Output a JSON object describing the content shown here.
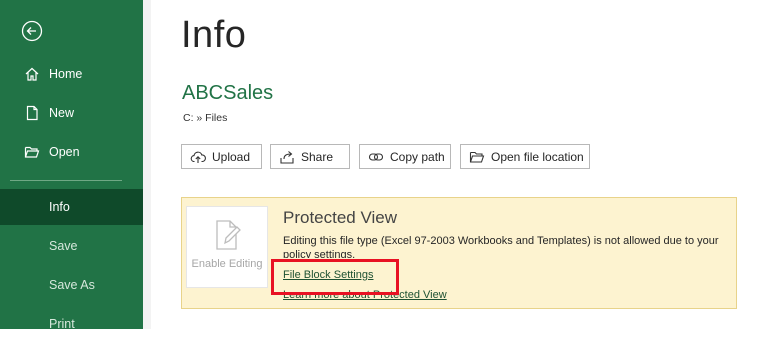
{
  "sidebar": {
    "back_icon": "back-arrow-icon",
    "items": [
      {
        "label": "Home",
        "icon": "home-icon"
      },
      {
        "label": "New",
        "icon": "new-file-icon"
      },
      {
        "label": "Open",
        "icon": "folder-open-icon"
      },
      {
        "label": "Info",
        "active": true
      },
      {
        "label": "Save"
      },
      {
        "label": "Save As"
      },
      {
        "label": "Print"
      }
    ],
    "colors": {
      "background": "#217346",
      "active": "#0f4a2a"
    }
  },
  "main": {
    "title": "Info",
    "file_name": "ABCSales",
    "file_path": "C: » Files",
    "actions": [
      {
        "label": "Upload",
        "icon": "upload-icon"
      },
      {
        "label": "Share",
        "icon": "share-icon"
      },
      {
        "label": "Copy path",
        "icon": "link-icon"
      },
      {
        "label": "Open file location",
        "icon": "folder-icon"
      }
    ]
  },
  "protected_view": {
    "enable_label": "Enable Editing",
    "title": "Protected View",
    "message": "Editing this file type (Excel 97-2003 Workbooks and Templates) is not allowed due to your policy settings.",
    "link_settings": "File Block Settings",
    "link_learn": "Learn more about Protected View",
    "colors": {
      "background": "#fdf3d0",
      "highlight": "#e81123"
    }
  }
}
